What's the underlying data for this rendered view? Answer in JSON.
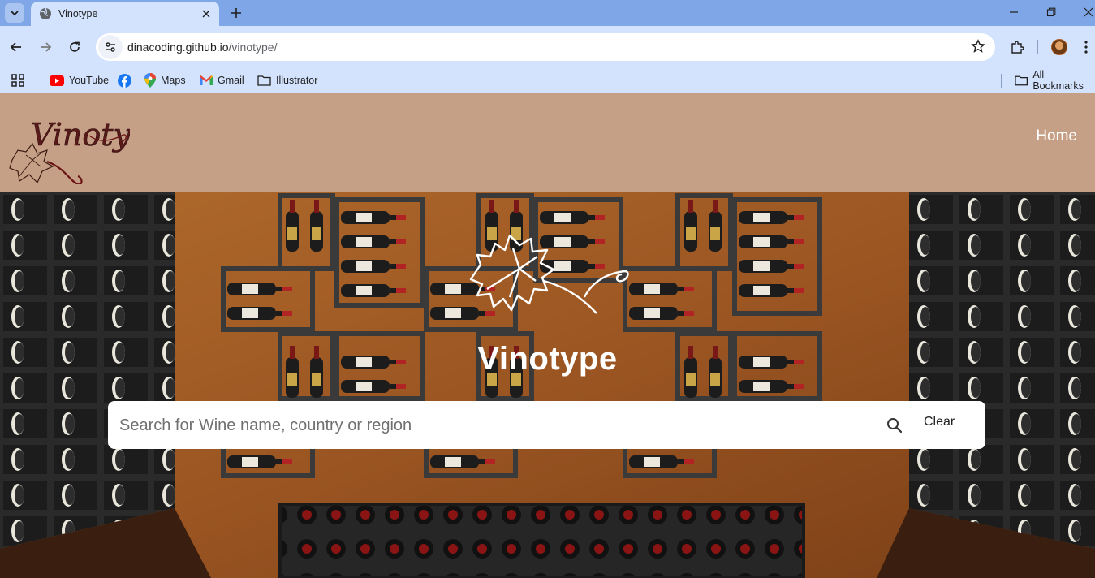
{
  "browser": {
    "tab_title": "Vinotype",
    "url_host": "dinacoding.github.io",
    "url_path": "/vinotype/",
    "bookmarks": [
      {
        "label": "YouTube",
        "icon": "youtube-icon"
      },
      {
        "label": "",
        "icon": "facebook-icon"
      },
      {
        "label": "Maps",
        "icon": "maps-icon"
      },
      {
        "label": "Gmail",
        "icon": "gmail-icon"
      },
      {
        "label": "Illustrator",
        "icon": "folder-icon"
      }
    ],
    "all_bookmarks": "All Bookmarks"
  },
  "site": {
    "logo_text": "Vinotype",
    "nav": {
      "home": "Home"
    },
    "hero": {
      "title": "Vinotype",
      "search_placeholder": "Search for Wine name, country or region",
      "clear_label": "Clear"
    }
  },
  "colors": {
    "header_bg": "#c6a086",
    "chrome_tabstrip": "#7fa6e6",
    "chrome_toolbar": "#d3e3fd",
    "wood": "#9a5522"
  }
}
